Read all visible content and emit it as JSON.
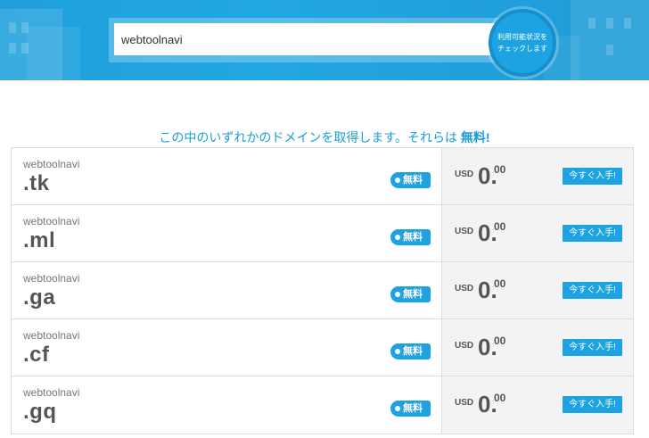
{
  "search": {
    "value": "webtoolnavi",
    "check_label": "利用可能状況をチェックします"
  },
  "headline": {
    "text": "この中のいずれかのドメインを取得します。それらは ",
    "emphasis": "無料!"
  },
  "domains": [
    {
      "name": "webtoolnavi",
      "tld": ".tk",
      "badge": "無料",
      "currency": "USD",
      "price": "0.",
      "cents": "00",
      "button": "今すぐ入手!"
    },
    {
      "name": "webtoolnavi",
      "tld": ".ml",
      "badge": "無料",
      "currency": "USD",
      "price": "0.",
      "cents": "00",
      "button": "今すぐ入手!"
    },
    {
      "name": "webtoolnavi",
      "tld": ".ga",
      "badge": "無料",
      "currency": "USD",
      "price": "0.",
      "cents": "00",
      "button": "今すぐ入手!"
    },
    {
      "name": "webtoolnavi",
      "tld": ".cf",
      "badge": "無料",
      "currency": "USD",
      "price": "0.",
      "cents": "00",
      "button": "今すぐ入手!"
    },
    {
      "name": "webtoolnavi",
      "tld": ".gq",
      "badge": "無料",
      "currency": "USD",
      "price": "0.",
      "cents": "00",
      "button": "今すぐ入手!"
    }
  ],
  "colors": {
    "accent": "#1ea3e2",
    "text": "#555555",
    "row_right_bg": "#f3f3f3"
  }
}
